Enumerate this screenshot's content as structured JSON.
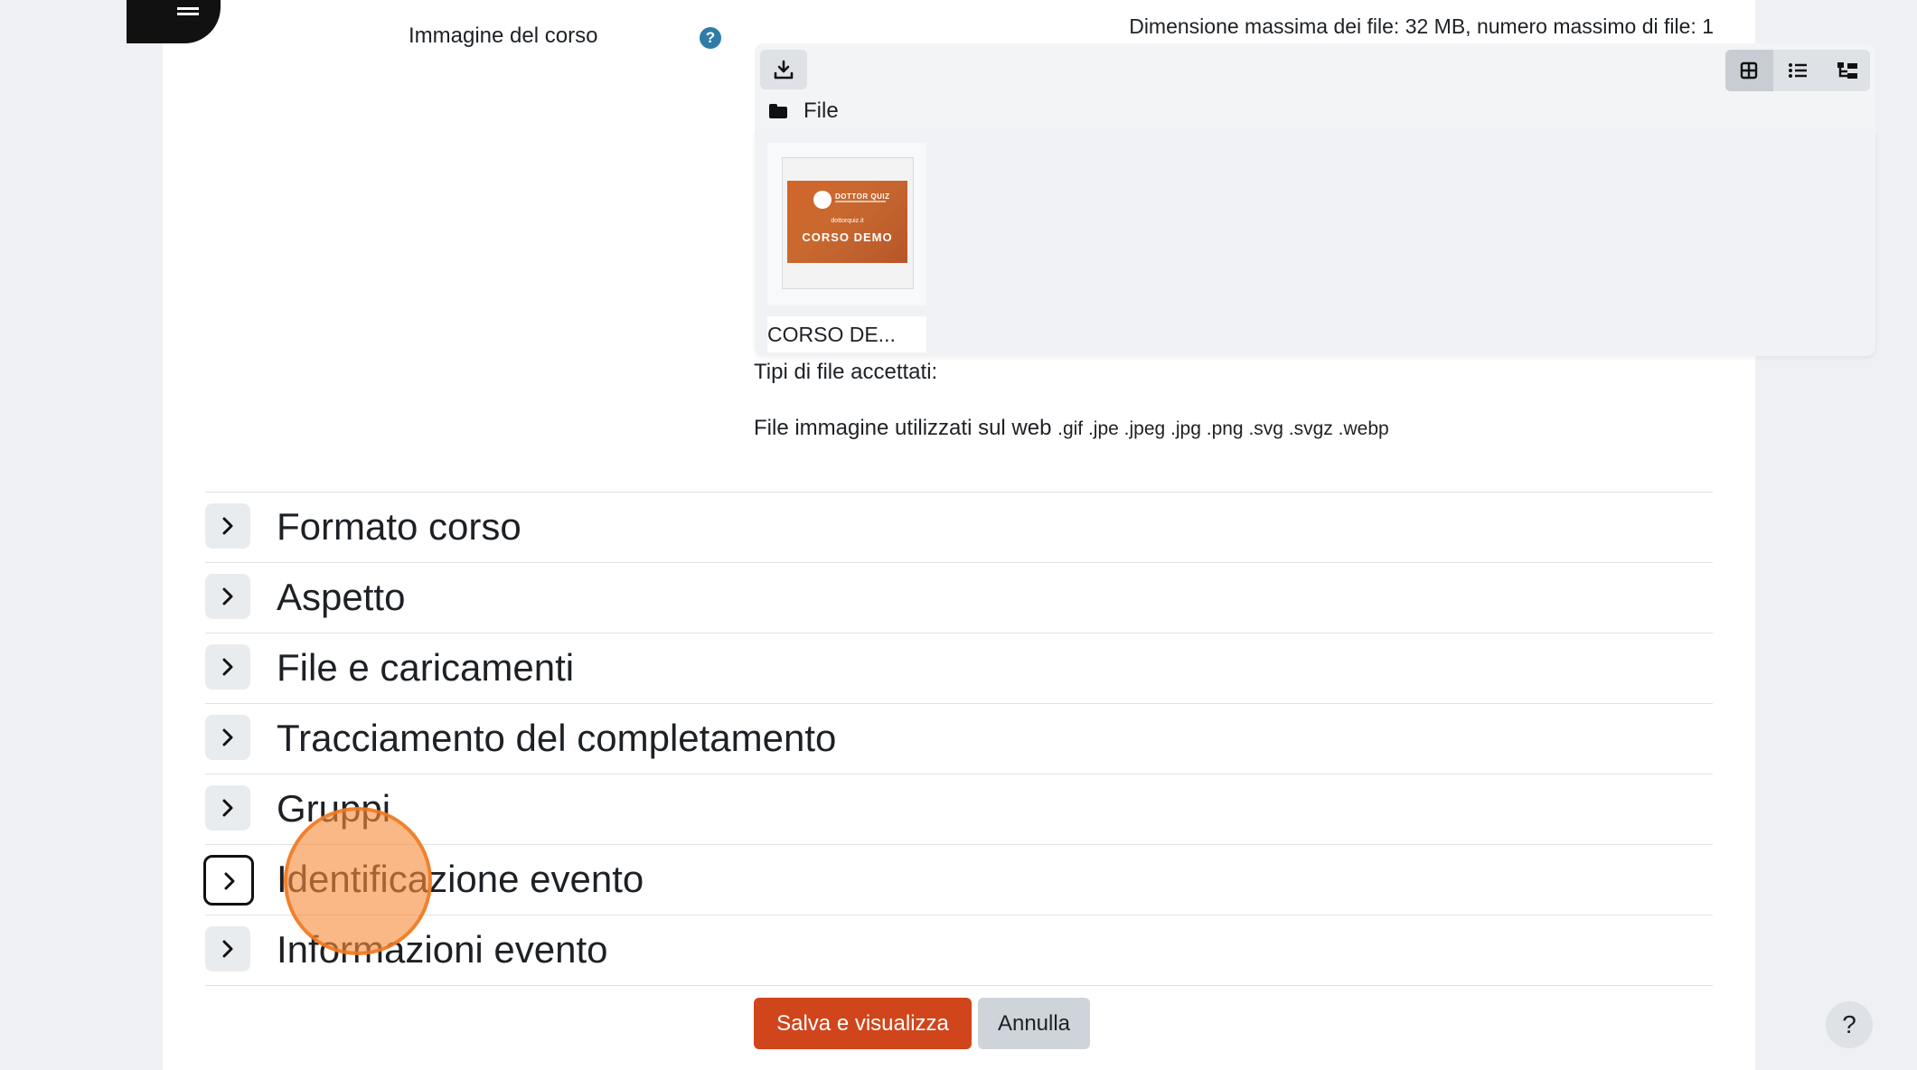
{
  "field": {
    "label": "Immagine del corso",
    "help": "?"
  },
  "filemanager": {
    "limits": "Dimensione massima dei file: 32 MB, numero massimo di file: 1",
    "path_label": "File",
    "files": [
      {
        "name": "CORSO DE...",
        "thumbnail": {
          "brand": "DOTTOR QUIZ",
          "caption": "dottorquiz.it",
          "title": "CORSO DEMO"
        }
      }
    ]
  },
  "accepted": {
    "title": "Tipi di file accettati:",
    "description": "File immagine utilizzati sul web",
    "extensions": ".gif .jpe .jpeg .jpg .png .svg .svgz .webp"
  },
  "sections": [
    {
      "title": "Formato corso"
    },
    {
      "title": "Aspetto"
    },
    {
      "title": "File e caricamenti"
    },
    {
      "title": "Tracciamento del completamento"
    },
    {
      "title": "Gruppi"
    },
    {
      "title": "Identificazione evento"
    },
    {
      "title": "Informazioni evento"
    }
  ],
  "buttons": {
    "save": "Salva e visualizza",
    "cancel": "Annulla"
  },
  "help_fab": "?",
  "colors": {
    "primary": "#d0451b",
    "secondary": "#ced4da",
    "help_icon": "#2f7ca8",
    "click_marker": "#f78c3c"
  }
}
